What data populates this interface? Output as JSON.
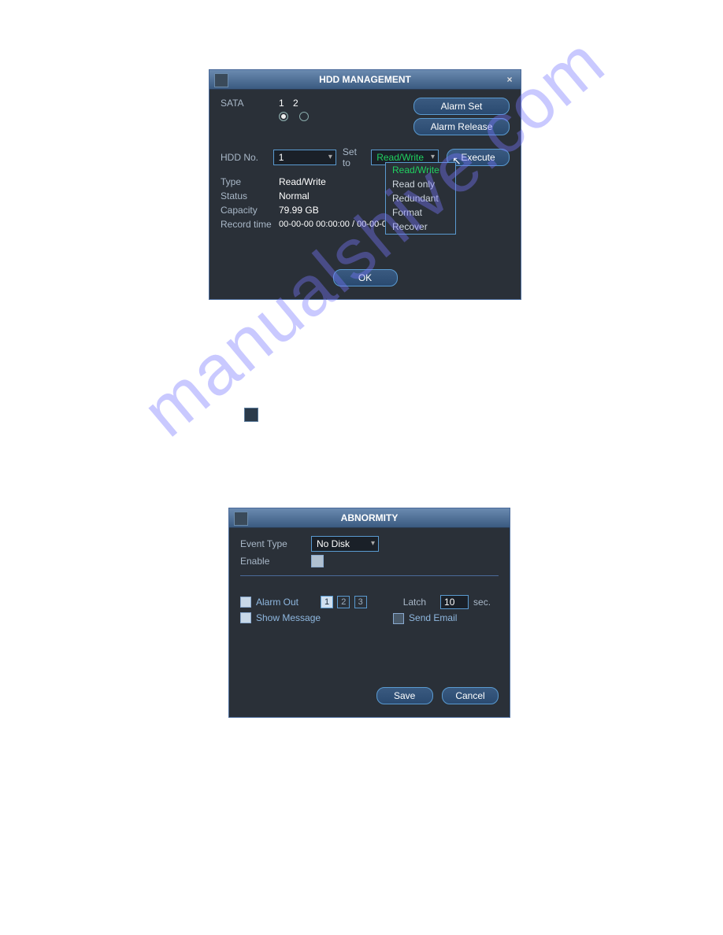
{
  "hdd": {
    "title": "HDD MANAGEMENT",
    "sata_label": "SATA",
    "sata_cols": [
      "1",
      "2"
    ],
    "alarm_set": "Alarm Set",
    "alarm_release": "Alarm Release",
    "hdd_no_label": "HDD No.",
    "hdd_no_value": "1",
    "set_to_label": "Set to",
    "set_to_value": "Read/Write",
    "set_to_options": [
      "Read/Write",
      "Read only",
      "Redundant",
      "Format",
      "Recover"
    ],
    "execute": "Execute",
    "type_label": "Type",
    "type_value": "Read/Write",
    "status_label": "Status",
    "status_value": "Normal",
    "capacity_label": "Capacity",
    "capacity_value": "79.99 GB",
    "recordtime_label": "Record time",
    "recordtime_value": "00-00-00 00:00:00 / 00-00-00 00:00:00",
    "ok": "OK"
  },
  "abn": {
    "title": "ABNORMITY",
    "event_type_label": "Event Type",
    "event_type_value": "No Disk",
    "enable_label": "Enable",
    "alarm_out_label": "Alarm Out",
    "alarm_out_opts": [
      "1",
      "2",
      "3"
    ],
    "latch_label": "Latch",
    "latch_value": "10",
    "latch_unit": "sec.",
    "show_message_label": "Show Message",
    "send_email_label": "Send Email",
    "save": "Save",
    "cancel": "Cancel"
  }
}
